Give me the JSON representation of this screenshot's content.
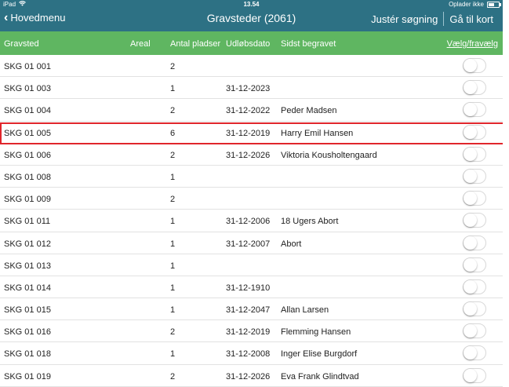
{
  "status": {
    "device": "iPad",
    "time": "13.54",
    "charging": "Oplader ikke",
    "battery_level": 0.6
  },
  "nav": {
    "back_label": "Hovedmenu",
    "title": "Gravsteder (2061)",
    "adjust_search": "Justér søgning",
    "go_to_map": "Gå til kort"
  },
  "columns": {
    "gravsted": "Gravsted",
    "areal": "Areal",
    "antal": "Antal pladser",
    "udlob": "Udløbsdato",
    "sidst": "Sidst begravet",
    "toggle_all": "Vælg/fravælg"
  },
  "rows": [
    {
      "gravsted": "SKG 01  001",
      "areal": "",
      "antal": "2",
      "udlob": "",
      "sidst": "",
      "selected": false
    },
    {
      "gravsted": "SKG 01  003",
      "areal": "",
      "antal": "1",
      "udlob": "31-12-2023",
      "sidst": "",
      "selected": false
    },
    {
      "gravsted": "SKG 01  004",
      "areal": "",
      "antal": "2",
      "udlob": "31-12-2022",
      "sidst": "Peder Madsen",
      "selected": false
    },
    {
      "gravsted": "SKG 01  005",
      "areal": "",
      "antal": "6",
      "udlob": "31-12-2019",
      "sidst": "Harry Emil Hansen",
      "selected": false
    },
    {
      "gravsted": "SKG 01  006",
      "areal": "",
      "antal": "2",
      "udlob": "31-12-2026",
      "sidst": "Viktoria Kousholtengaard",
      "selected": false
    },
    {
      "gravsted": "SKG 01  008",
      "areal": "",
      "antal": "1",
      "udlob": "",
      "sidst": "",
      "selected": false
    },
    {
      "gravsted": "SKG 01  009",
      "areal": "",
      "antal": "2",
      "udlob": "",
      "sidst": "",
      "selected": false
    },
    {
      "gravsted": "SKG 01  011",
      "areal": "",
      "antal": "1",
      "udlob": "31-12-2006",
      "sidst": "18 Ugers Abort",
      "selected": false
    },
    {
      "gravsted": "SKG 01  012",
      "areal": "",
      "antal": "1",
      "udlob": "31-12-2007",
      "sidst": "Abort",
      "selected": false
    },
    {
      "gravsted": "SKG 01  013",
      "areal": "",
      "antal": "1",
      "udlob": "",
      "sidst": "",
      "selected": false
    },
    {
      "gravsted": "SKG 01  014",
      "areal": "",
      "antal": "1",
      "udlob": "31-12-1910",
      "sidst": "",
      "selected": false
    },
    {
      "gravsted": "SKG 01  015",
      "areal": "",
      "antal": "1",
      "udlob": "31-12-2047",
      "sidst": "Allan Larsen",
      "selected": false
    },
    {
      "gravsted": "SKG 01  016",
      "areal": "",
      "antal": "2",
      "udlob": "31-12-2019",
      "sidst": "Flemming Hansen",
      "selected": false
    },
    {
      "gravsted": "SKG 01  018",
      "areal": "",
      "antal": "1",
      "udlob": "31-12-2008",
      "sidst": "Inger Elise Burgdorf",
      "selected": false
    },
    {
      "gravsted": "SKG 01  019",
      "areal": "",
      "antal": "2",
      "udlob": "31-12-2026",
      "sidst": "Eva Frank Glindtvad",
      "selected": false
    }
  ],
  "colors": {
    "nav_bg": "#2d7184",
    "header_bg": "#5fb661",
    "highlight": "#e0262c"
  }
}
